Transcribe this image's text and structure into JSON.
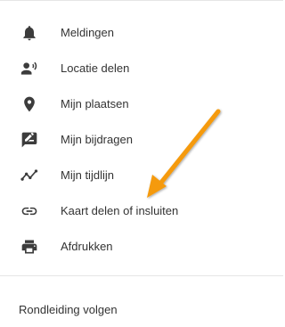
{
  "menu": {
    "items": [
      {
        "label": "Meldingen",
        "icon": "bell-icon"
      },
      {
        "label": "Locatie delen",
        "icon": "person-share-icon"
      },
      {
        "label": "Mijn plaatsen",
        "icon": "location-pin-icon"
      },
      {
        "label": "Mijn bijdragen",
        "icon": "edit-comment-icon"
      },
      {
        "label": "Mijn tijdlijn",
        "icon": "timeline-icon"
      },
      {
        "label": "Kaart delen of insluiten",
        "icon": "link-icon"
      },
      {
        "label": "Afdrukken",
        "icon": "printer-icon"
      }
    ]
  },
  "footer": {
    "tour_label": "Rondleiding volgen"
  },
  "colors": {
    "icon": "#3c3c3c",
    "text": "#333333",
    "divider": "#e6e6e6",
    "arrow": "#f59a0b"
  }
}
